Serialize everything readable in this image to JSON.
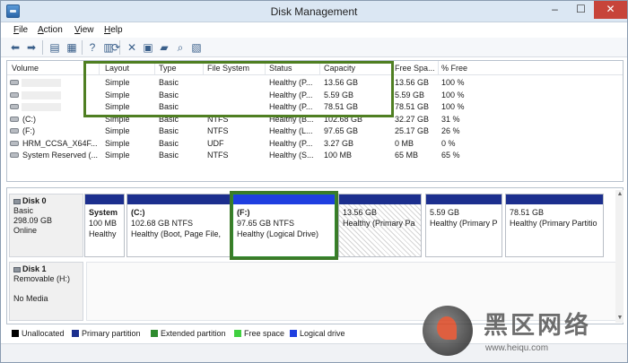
{
  "window": {
    "title": "Disk Management",
    "minimize": "–",
    "maximize": "☐",
    "close": "✕"
  },
  "menu": [
    "File",
    "Action",
    "View",
    "Help"
  ],
  "menu_access_keys": [
    "F",
    "A",
    "V",
    "H"
  ],
  "toolbar_icons": [
    "back-arrow-icon",
    "forward-arrow-icon",
    "console-tree-icon",
    "properties-icon",
    "help-icon",
    "details-pane-icon",
    "refresh-icon",
    "delete-icon",
    "properties-sheet-icon",
    "open-icon",
    "explore-icon",
    "settings-icon"
  ],
  "volume_table": {
    "columns": [
      "Volume",
      "Layout",
      "Type",
      "File System",
      "Status",
      "Capacity",
      "Free Spa...",
      "% Free"
    ],
    "rows": [
      {
        "volume": "",
        "layout": "Simple",
        "type": "Basic",
        "fs": "",
        "status": "Healthy (P...",
        "capacity": "13.56 GB",
        "free": "13.56 GB",
        "pct": "100 %"
      },
      {
        "volume": "",
        "layout": "Simple",
        "type": "Basic",
        "fs": "",
        "status": "Healthy (P...",
        "capacity": "5.59 GB",
        "free": "5.59 GB",
        "pct": "100 %"
      },
      {
        "volume": "",
        "layout": "Simple",
        "type": "Basic",
        "fs": "",
        "status": "Healthy (P...",
        "capacity": "78.51 GB",
        "free": "78.51 GB",
        "pct": "100 %"
      },
      {
        "volume": "(C:)",
        "layout": "Simple",
        "type": "Basic",
        "fs": "NTFS",
        "status": "Healthy (B...",
        "capacity": "102.68 GB",
        "free": "32.27 GB",
        "pct": "31 %"
      },
      {
        "volume": "(F:)",
        "layout": "Simple",
        "type": "Basic",
        "fs": "NTFS",
        "status": "Healthy (L...",
        "capacity": "97.65 GB",
        "free": "25.17 GB",
        "pct": "26 %"
      },
      {
        "volume": "HRM_CCSA_X64F...",
        "layout": "Simple",
        "type": "Basic",
        "fs": "UDF",
        "status": "Healthy (P...",
        "capacity": "3.27 GB",
        "free": "0 MB",
        "pct": "0 %"
      },
      {
        "volume": "System Reserved (...",
        "layout": "Simple",
        "type": "Basic",
        "fs": "NTFS",
        "status": "Healthy (S...",
        "capacity": "100 MB",
        "free": "65 MB",
        "pct": "65 %"
      }
    ]
  },
  "disks": [
    {
      "name": "Disk 0",
      "lines": [
        "Basic",
        "298.09 GB",
        "Online"
      ],
      "partitions": [
        {
          "title": "System",
          "size": "100 MB",
          "status": "Healthy"
        },
        {
          "title": "(C:)",
          "size": "102.68 GB NTFS",
          "status": "Healthy (Boot, Page File,"
        },
        {
          "title": "(F:)",
          "size": "97.65 GB NTFS",
          "status": "Healthy (Logical Drive)"
        },
        {
          "title": "",
          "size": "13.56 GB",
          "status": "Healthy (Primary Pa"
        },
        {
          "title": "",
          "size": "5.59 GB",
          "status": "Healthy (Primary P"
        },
        {
          "title": "",
          "size": "78.51 GB",
          "status": "Healthy (Primary Partitio"
        }
      ]
    },
    {
      "name": "Disk 1",
      "lines": [
        "Removable (H:)",
        "",
        "No Media"
      ]
    }
  ],
  "legend": [
    {
      "label": "Unallocated",
      "color": "#000000"
    },
    {
      "label": "Primary partition",
      "color": "#1c2f8e"
    },
    {
      "label": "Extended partition",
      "color": "#2e8b2e"
    },
    {
      "label": "Free space",
      "color": "#40d040"
    },
    {
      "label": "Logical drive",
      "color": "#1f3fe0"
    }
  ],
  "colors": {
    "primary_bar": "#1c2f8e",
    "logical_bar": "#1f3fe0",
    "highlight": "#4f7f22"
  },
  "watermark": {
    "title": "黑区网络",
    "url": "www.heiqu.com"
  }
}
